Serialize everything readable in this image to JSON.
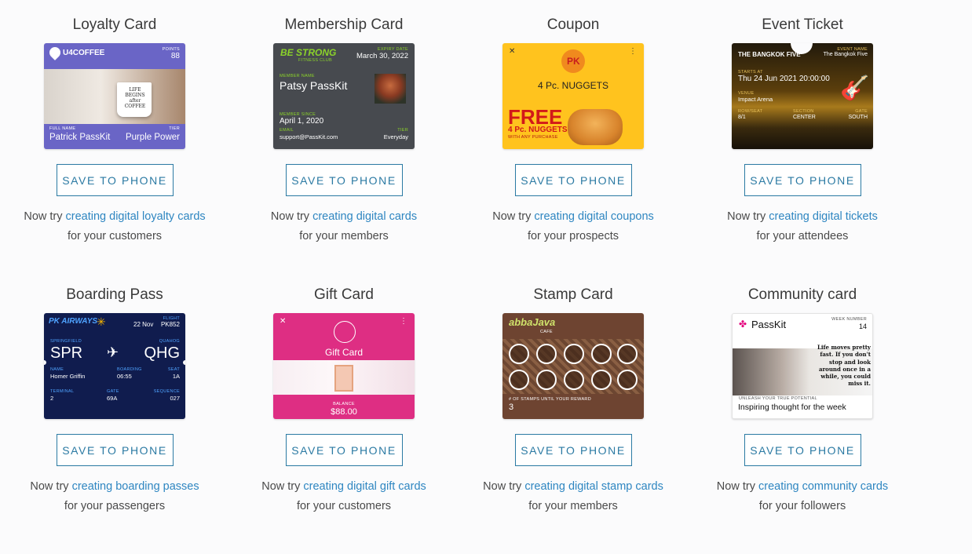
{
  "tiles": [
    {
      "title": "Loyalty Card",
      "button": "SAVE TO PHONE",
      "pre": "Now try",
      "link": "creating digital loyalty cards",
      "post": "for your customers"
    },
    {
      "title": "Membership Card",
      "button": "SAVE TO PHONE",
      "pre": "Now try",
      "link": "creating digital cards",
      "post": "for your members"
    },
    {
      "title": "Coupon",
      "button": "SAVE TO PHONE",
      "pre": "Now try",
      "link": "creating digital coupons",
      "post": "for your prospects"
    },
    {
      "title": "Event Ticket",
      "button": "SAVE TO PHONE",
      "pre": "Now try",
      "link": "creating digital tickets",
      "post": "for your attendees"
    },
    {
      "title": "Boarding Pass",
      "button": "SAVE TO PHONE",
      "pre": "Now try",
      "link": "creating boarding passes",
      "post": "for your passengers"
    },
    {
      "title": "Gift Card",
      "button": "SAVE TO PHONE",
      "pre": "Now try",
      "link": "creating digital gift cards",
      "post": "for your customers"
    },
    {
      "title": "Stamp Card",
      "button": "SAVE TO PHONE",
      "pre": "Now try",
      "link": "creating digital stamp cards",
      "post": "for your members"
    },
    {
      "title": "Community card",
      "button": "SAVE TO PHONE",
      "pre": "Now try",
      "link": "creating community cards",
      "post": "for your followers"
    }
  ],
  "cards": {
    "loyalty": {
      "brand": "U4COFFEE",
      "points_label": "POINTS",
      "points": "88",
      "mug_text": "LIFE BEGINS after COFFEE",
      "name_label": "FULL NAME",
      "name": "Patrick PassKit",
      "tier_label": "TIER",
      "tier": "Purple Power"
    },
    "membership": {
      "brand": "BE STRONG",
      "brand_sub": "FITNESS CLUB",
      "expiry_label": "EXPIRY DATE",
      "expiry": "March 30, 2022",
      "member_label": "MEMBER NAME",
      "member": "Patsy PassKit",
      "since_label": "MEMBER SINCE",
      "since": "April 1, 2020",
      "email_label": "EMAIL",
      "email": "support@PassKit.com",
      "tier_label": "TIER",
      "tier": "Everyday"
    },
    "coupon": {
      "logo": "PK",
      "offer": "4 Pc. NUGGETS",
      "free": "FREE",
      "free_sub": "4 Pc. NUGGETS",
      "free_note": "WITH ANY PURCHASE"
    },
    "event": {
      "title": "THE BANGKOK FIVE",
      "event_label": "EVENT NAME",
      "event": "The Bangkok Five",
      "starts_label": "STARTS AT",
      "starts": "Thu 24 Jun 2021 20:00:00",
      "venue_label": "VENUE",
      "venue": "Impact Arena",
      "row_label": "ROW/SEAT",
      "row": "8/1",
      "section_label": "SECTION",
      "section": "CENTER",
      "gate_label": "GATE",
      "gate": "SOUTH"
    },
    "boarding": {
      "airline": "PK AIRWAYS",
      "date": "22 Nov",
      "flight_label": "FLIGHT",
      "flight": "PK852",
      "from_city": "SPRINGFIELD",
      "from": "SPR",
      "to_city": "QUAHOG",
      "to": "QHG",
      "name_label": "NAME",
      "name": "Homer Griffin",
      "boarding_label": "BOARDING",
      "boarding": "06:55",
      "seat_label": "SEAT",
      "seat": "1A",
      "terminal_label": "TERMINAL",
      "terminal": "2",
      "gate_label": "GATE",
      "gate": "69A",
      "sequence_label": "SEQUENCE",
      "sequence": "027"
    },
    "gift": {
      "title": "Gift Card",
      "balance_label": "BALANCE",
      "balance": "$88.00"
    },
    "stamp": {
      "brand": "abbaJava",
      "brand_sub": "CAFE",
      "count_label": "# OF STAMPS UNTIL YOUR REWARD",
      "count": "3"
    },
    "community": {
      "brand": "PassKit",
      "week_label": "WEEK NUMBER",
      "week": "14",
      "quote": "Life moves pretty fast. If you don't stop and look around once in a while, you could miss it.",
      "potential_label": "UNLEASH YOUR TRUE POTENTIAL",
      "thought": "Inspiring thought for the week"
    }
  },
  "colors": {
    "accent": "#2b7aa3",
    "link": "#2e86c1",
    "loyalty": "#6a65c6",
    "membership": "#474a4f",
    "coupon": "#ffc31e",
    "boarding": "#101c4e",
    "gift": "#de2e83",
    "stamp": "#6e4431"
  }
}
